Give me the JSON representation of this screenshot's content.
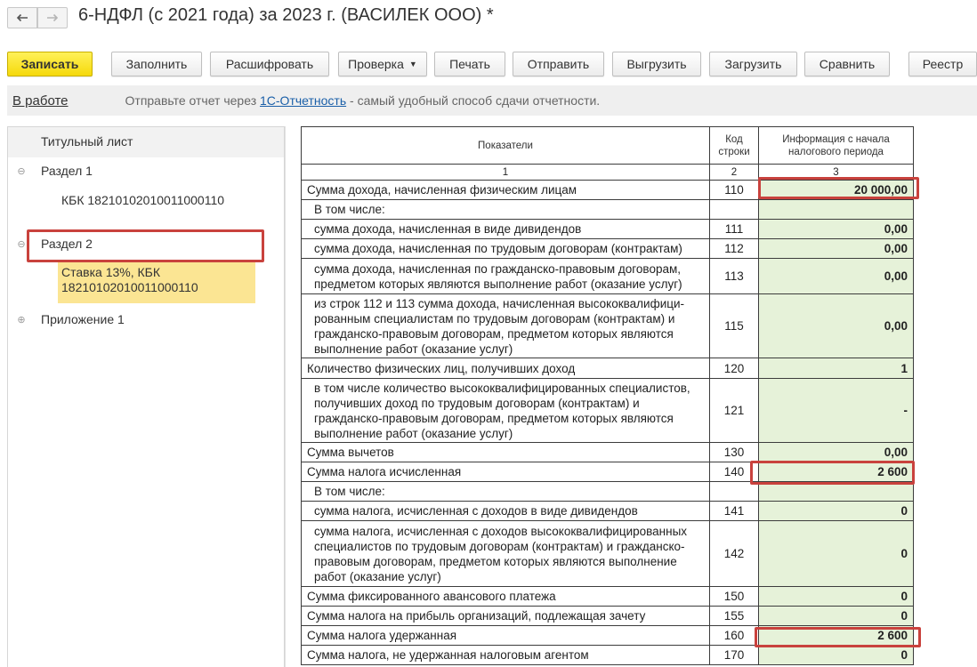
{
  "window": {
    "title": "6-НДФЛ (с 2021 года) за 2023 г. (ВАСИЛЕК ООО) *"
  },
  "toolbar": {
    "save": "Записать",
    "fill": "Заполнить",
    "decode": "Расшифровать",
    "check": "Проверка",
    "print": "Печать",
    "send": "Отправить",
    "export": "Выгрузить",
    "import": "Загрузить",
    "compare": "Сравнить",
    "registry": "Реестр"
  },
  "infobar": {
    "status": "В работе",
    "msg_before": "Отправьте отчет через ",
    "msg_link": "1С-Отчетность",
    "msg_after": " - самый удобный способ сдачи отчетности."
  },
  "tree": {
    "title_page": "Титульный лист",
    "section1": "Раздел 1",
    "section1_kbk": "КБК 18210102010011000110",
    "section2": "Раздел 2",
    "section2_sub_line1": "Ставка 13%, КБК",
    "section2_sub_line2": "18210102010011000110",
    "appendix1": "Приложение 1"
  },
  "grid": {
    "header": {
      "indicators": "Показатели",
      "code": "Код строки",
      "info": "Информация с начала налогового периода"
    },
    "colnums": [
      "1",
      "2",
      "3"
    ],
    "rows": [
      {
        "label": "Сумма дохода, начисленная физическим лицам",
        "code": "110",
        "value": "20 000,00"
      },
      {
        "label": "В том числе:",
        "code": "",
        "value": ""
      },
      {
        "label": "сумма дохода, начисленная в виде дивидендов",
        "code": "111",
        "value": "0,00"
      },
      {
        "label": "сумма дохода, начисленная по трудовым договорам (контрактам)",
        "code": "112",
        "value": "0,00"
      },
      {
        "label": "сумма дохода, начисленная по гражданско-правовым договорам, предметом которых являются выполнение работ (оказание услуг)",
        "code": "113",
        "value": "0,00"
      },
      {
        "label": "из строк 112 и 113 сумма дохода, начисленная высококвалифици-рованным специалистам по трудовым договорам (контрактам) и гражданско-правовым договорам, предметом которых являются выполнение работ (оказание услуг)",
        "code": "115",
        "value": "0,00"
      },
      {
        "label": "Количество физических лиц, получивших доход",
        "code": "120",
        "value": "1"
      },
      {
        "label": "в том числе количество высококвалифицированных специалистов, получивших доход по трудовым договорам (контрактам) и гражданско-правовым договорам, предметом которых являются выполнение работ (оказание услуг)",
        "code": "121",
        "value": "-"
      },
      {
        "label": "Сумма вычетов",
        "code": "130",
        "value": "0,00"
      },
      {
        "label": "Сумма налога исчисленная",
        "code": "140",
        "value": "2 600"
      },
      {
        "label": "В том числе:",
        "code": "",
        "value": ""
      },
      {
        "label": "сумма налога, исчисленная с доходов в виде дивидендов",
        "code": "141",
        "value": "0"
      },
      {
        "label": "сумма налога, исчисленная с доходов высококвалифицированных специалистов по трудовым договорам (контрактам) и гражданско-правовым договорам, предметом которых являются выполнение работ (оказание услуг)",
        "code": "142",
        "value": "0"
      },
      {
        "label": "Сумма фиксированного авансового платежа",
        "code": "150",
        "value": "0"
      },
      {
        "label": "Сумма налога на прибыль организаций, подлежащая зачету",
        "code": "155",
        "value": "0"
      },
      {
        "label": "Сумма налога удержанная",
        "code": "160",
        "value": "2 600"
      },
      {
        "label": "Сумма налога, не удержанная налоговым агентом",
        "code": "170",
        "value": "0"
      }
    ]
  },
  "colors": {
    "primary_button": "#f5d90a",
    "selected_tree_item": "#fbe593",
    "value_cell": "#e6f2d9",
    "highlight": "#c9423d",
    "link": "#1a5fa8"
  }
}
